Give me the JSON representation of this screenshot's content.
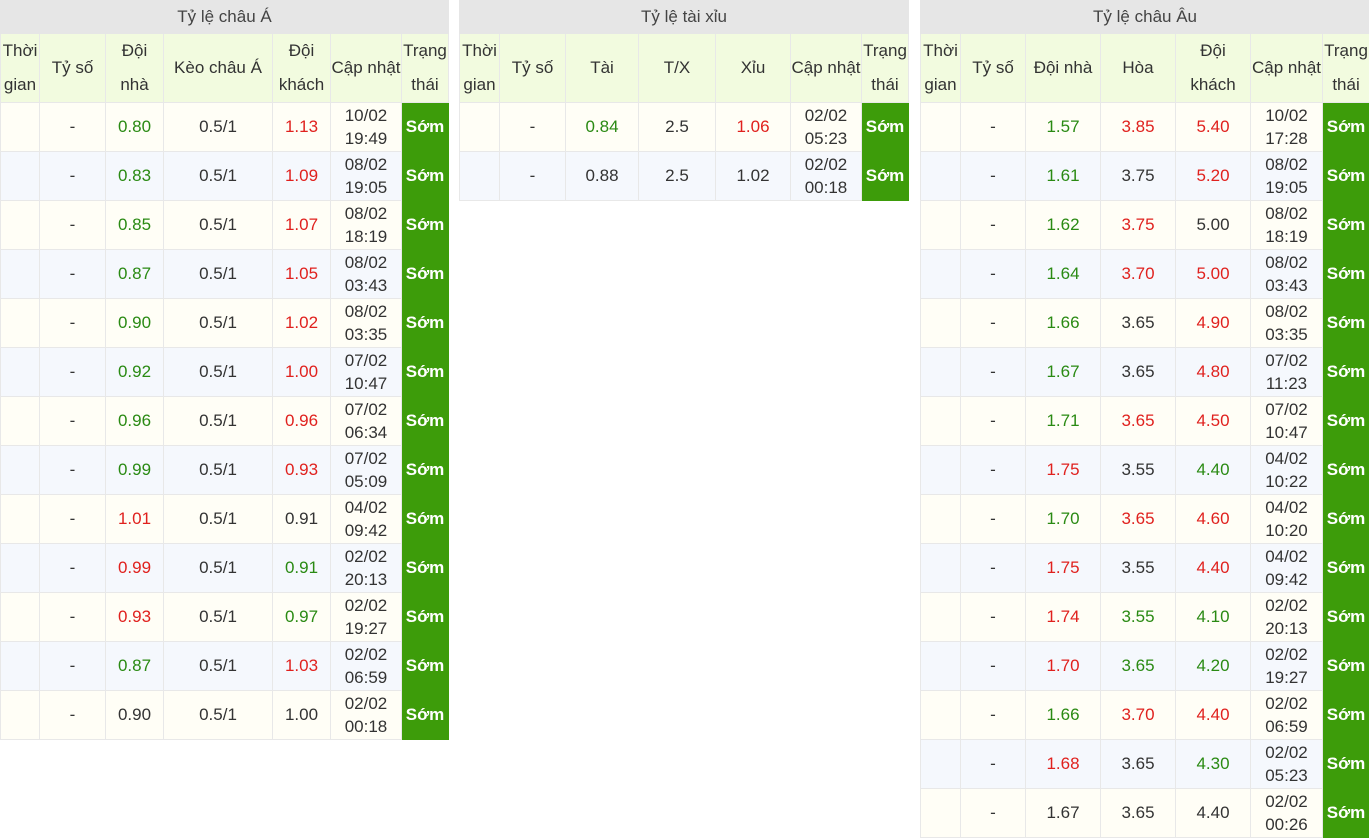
{
  "asian": {
    "title": "Tỷ lệ châu Á",
    "headers": [
      "Thời gian",
      "Tỷ số",
      "Đội nhà",
      "Kèo châu Á",
      "Đội khách",
      "Cập nhật",
      "Trạng thái"
    ],
    "rows": [
      {
        "time": "",
        "score": "-",
        "home": "0.80",
        "home_c": "g",
        "line": "0.5/1",
        "away": "1.13",
        "away_c": "r",
        "upd1": "10/02",
        "upd2": "19:49",
        "status": "Sớm"
      },
      {
        "time": "",
        "score": "-",
        "home": "0.83",
        "home_c": "g",
        "line": "0.5/1",
        "away": "1.09",
        "away_c": "r",
        "upd1": "08/02",
        "upd2": "19:05",
        "status": "Sớm"
      },
      {
        "time": "",
        "score": "-",
        "home": "0.85",
        "home_c": "g",
        "line": "0.5/1",
        "away": "1.07",
        "away_c": "r",
        "upd1": "08/02",
        "upd2": "18:19",
        "status": "Sớm"
      },
      {
        "time": "",
        "score": "-",
        "home": "0.87",
        "home_c": "g",
        "line": "0.5/1",
        "away": "1.05",
        "away_c": "r",
        "upd1": "08/02",
        "upd2": "03:43",
        "status": "Sớm"
      },
      {
        "time": "",
        "score": "-",
        "home": "0.90",
        "home_c": "g",
        "line": "0.5/1",
        "away": "1.02",
        "away_c": "r",
        "upd1": "08/02",
        "upd2": "03:35",
        "status": "Sớm"
      },
      {
        "time": "",
        "score": "-",
        "home": "0.92",
        "home_c": "g",
        "line": "0.5/1",
        "away": "1.00",
        "away_c": "r",
        "upd1": "07/02",
        "upd2": "10:47",
        "status": "Sớm"
      },
      {
        "time": "",
        "score": "-",
        "home": "0.96",
        "home_c": "g",
        "line": "0.5/1",
        "away": "0.96",
        "away_c": "r",
        "upd1": "07/02",
        "upd2": "06:34",
        "status": "Sớm"
      },
      {
        "time": "",
        "score": "-",
        "home": "0.99",
        "home_c": "g",
        "line": "0.5/1",
        "away": "0.93",
        "away_c": "r",
        "upd1": "07/02",
        "upd2": "05:09",
        "status": "Sớm"
      },
      {
        "time": "",
        "score": "-",
        "home": "1.01",
        "home_c": "r",
        "line": "0.5/1",
        "away": "0.91",
        "away_c": "n",
        "upd1": "04/02",
        "upd2": "09:42",
        "status": "Sớm"
      },
      {
        "time": "",
        "score": "-",
        "home": "0.99",
        "home_c": "r",
        "line": "0.5/1",
        "away": "0.91",
        "away_c": "g",
        "upd1": "02/02",
        "upd2": "20:13",
        "status": "Sớm"
      },
      {
        "time": "",
        "score": "-",
        "home": "0.93",
        "home_c": "r",
        "line": "0.5/1",
        "away": "0.97",
        "away_c": "g",
        "upd1": "02/02",
        "upd2": "19:27",
        "status": "Sớm"
      },
      {
        "time": "",
        "score": "-",
        "home": "0.87",
        "home_c": "g",
        "line": "0.5/1",
        "away": "1.03",
        "away_c": "r",
        "upd1": "02/02",
        "upd2": "06:59",
        "status": "Sớm"
      },
      {
        "time": "",
        "score": "-",
        "home": "0.90",
        "home_c": "n",
        "line": "0.5/1",
        "away": "1.00",
        "away_c": "n",
        "upd1": "02/02",
        "upd2": "00:18",
        "status": "Sớm"
      }
    ]
  },
  "overunder": {
    "title": "Tỷ lệ tài xỉu",
    "headers": [
      "Thời gian",
      "Tỷ số",
      "Tài",
      "T/X",
      "Xỉu",
      "Cập nhật",
      "Trạng thái"
    ],
    "rows": [
      {
        "time": "",
        "score": "-",
        "over": "0.84",
        "over_c": "g",
        "line": "2.5",
        "under": "1.06",
        "under_c": "r",
        "upd1": "02/02",
        "upd2": "05:23",
        "status": "Sớm"
      },
      {
        "time": "",
        "score": "-",
        "over": "0.88",
        "over_c": "n",
        "line": "2.5",
        "under": "1.02",
        "under_c": "n",
        "upd1": "02/02",
        "upd2": "00:18",
        "status": "Sớm"
      }
    ]
  },
  "european": {
    "title": "Tỷ lệ châu Âu",
    "headers": [
      "Thời gian",
      "Tỷ số",
      "Đội nhà",
      "Hòa",
      "Đội khách",
      "Cập nhật",
      "Trạng thái"
    ],
    "rows": [
      {
        "time": "",
        "score": "-",
        "home": "1.57",
        "home_c": "g",
        "draw": "3.85",
        "draw_c": "r",
        "away": "5.40",
        "away_c": "r",
        "upd1": "10/02",
        "upd2": "17:28",
        "status": "Sớm"
      },
      {
        "time": "",
        "score": "-",
        "home": "1.61",
        "home_c": "g",
        "draw": "3.75",
        "draw_c": "n",
        "away": "5.20",
        "away_c": "r",
        "upd1": "08/02",
        "upd2": "19:05",
        "status": "Sớm"
      },
      {
        "time": "",
        "score": "-",
        "home": "1.62",
        "home_c": "g",
        "draw": "3.75",
        "draw_c": "r",
        "away": "5.00",
        "away_c": "n",
        "upd1": "08/02",
        "upd2": "18:19",
        "status": "Sớm"
      },
      {
        "time": "",
        "score": "-",
        "home": "1.64",
        "home_c": "g",
        "draw": "3.70",
        "draw_c": "r",
        "away": "5.00",
        "away_c": "r",
        "upd1": "08/02",
        "upd2": "03:43",
        "status": "Sớm"
      },
      {
        "time": "",
        "score": "-",
        "home": "1.66",
        "home_c": "g",
        "draw": "3.65",
        "draw_c": "n",
        "away": "4.90",
        "away_c": "r",
        "upd1": "08/02",
        "upd2": "03:35",
        "status": "Sớm"
      },
      {
        "time": "",
        "score": "-",
        "home": "1.67",
        "home_c": "g",
        "draw": "3.65",
        "draw_c": "n",
        "away": "4.80",
        "away_c": "r",
        "upd1": "07/02",
        "upd2": "11:23",
        "status": "Sớm"
      },
      {
        "time": "",
        "score": "-",
        "home": "1.71",
        "home_c": "g",
        "draw": "3.65",
        "draw_c": "r",
        "away": "4.50",
        "away_c": "r",
        "upd1": "07/02",
        "upd2": "10:47",
        "status": "Sớm"
      },
      {
        "time": "",
        "score": "-",
        "home": "1.75",
        "home_c": "r",
        "draw": "3.55",
        "draw_c": "n",
        "away": "4.40",
        "away_c": "g",
        "upd1": "04/02",
        "upd2": "10:22",
        "status": "Sớm"
      },
      {
        "time": "",
        "score": "-",
        "home": "1.70",
        "home_c": "g",
        "draw": "3.65",
        "draw_c": "r",
        "away": "4.60",
        "away_c": "r",
        "upd1": "04/02",
        "upd2": "10:20",
        "status": "Sớm"
      },
      {
        "time": "",
        "score": "-",
        "home": "1.75",
        "home_c": "r",
        "draw": "3.55",
        "draw_c": "n",
        "away": "4.40",
        "away_c": "r",
        "upd1": "04/02",
        "upd2": "09:42",
        "status": "Sớm"
      },
      {
        "time": "",
        "score": "-",
        "home": "1.74",
        "home_c": "r",
        "draw": "3.55",
        "draw_c": "g",
        "away": "4.10",
        "away_c": "g",
        "upd1": "02/02",
        "upd2": "20:13",
        "status": "Sớm"
      },
      {
        "time": "",
        "score": "-",
        "home": "1.70",
        "home_c": "r",
        "draw": "3.65",
        "draw_c": "g",
        "away": "4.20",
        "away_c": "g",
        "upd1": "02/02",
        "upd2": "19:27",
        "status": "Sớm"
      },
      {
        "time": "",
        "score": "-",
        "home": "1.66",
        "home_c": "g",
        "draw": "3.70",
        "draw_c": "r",
        "away": "4.40",
        "away_c": "r",
        "upd1": "02/02",
        "upd2": "06:59",
        "status": "Sớm"
      },
      {
        "time": "",
        "score": "-",
        "home": "1.68",
        "home_c": "r",
        "draw": "3.65",
        "draw_c": "n",
        "away": "4.30",
        "away_c": "g",
        "upd1": "02/02",
        "upd2": "05:23",
        "status": "Sớm"
      },
      {
        "time": "",
        "score": "-",
        "home": "1.67",
        "home_c": "n",
        "draw": "3.65",
        "draw_c": "n",
        "away": "4.40",
        "away_c": "n",
        "upd1": "02/02",
        "upd2": "00:26",
        "status": "Sớm"
      }
    ]
  },
  "colors": {
    "status_bg": "#3d9c0a",
    "green": "#2a8a13",
    "red": "#e0211e",
    "header_bg": "#f2fbdf",
    "title_bg": "#e6e6e6"
  }
}
